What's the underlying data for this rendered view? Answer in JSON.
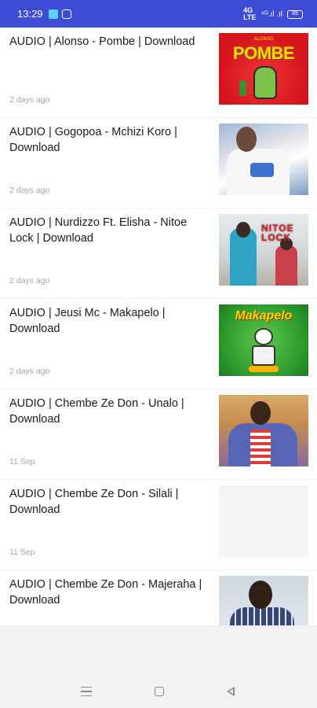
{
  "status_bar": {
    "time": "13:29",
    "data_indicator": "4G\nLTE",
    "signal": "⁴ᴳ.ıl .ıl",
    "battery_percent": "89",
    "icons": [
      "app-notification-icon",
      "message-icon",
      "signal-icon",
      "battery-icon"
    ]
  },
  "feed": {
    "posts": [
      {
        "title": "AUDIO | Alonso - Pombe | Download",
        "date": "2 days ago",
        "thumb_text": "POMBE",
        "thumb_small_text": "ALONSO"
      },
      {
        "title": "AUDIO | Gogopoa - Mchizi Koro | Download",
        "date": "2 days ago"
      },
      {
        "title": "AUDIO | Nurdizzo Ft. Elisha - Nitoe Lock | Download",
        "date": "2 days ago",
        "thumb_text_1": "NITOE",
        "thumb_text_2": "LOCK"
      },
      {
        "title": "AUDIO | Jeusi Mc - Makapelo | Download",
        "date": "2 days ago",
        "thumb_text": "Makapelo"
      },
      {
        "title": "AUDIO | Chembe Ze Don - Unalo | Download",
        "date": "11 Sep"
      },
      {
        "title": "AUDIO | Chembe Ze Don - Silali | Download",
        "date": "11 Sep"
      },
      {
        "title": "AUDIO | Chembe Ze Don - Majeraha | Download",
        "date": ""
      }
    ]
  },
  "nav_bar": {
    "icons": [
      "recent-apps-icon",
      "home-icon",
      "back-icon"
    ]
  }
}
